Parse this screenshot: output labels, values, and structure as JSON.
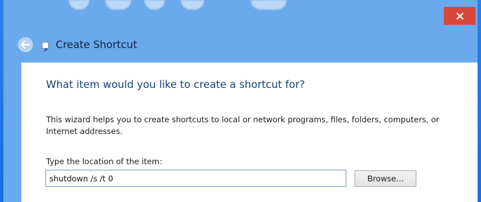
{
  "window": {
    "title": "Create Shortcut",
    "close_icon": "close-icon",
    "back_icon": "back-arrow-icon",
    "app_icon": "shortcut-icon",
    "close_color": "#d9473a",
    "frame_color": "#6aa9ec"
  },
  "wizard": {
    "heading": "What item would you like to create a shortcut for?",
    "description": "This wizard helps you to create shortcuts to local or network programs, files, folders, computers, or Internet addresses.",
    "location_label": "Type the location of the item:",
    "location_value": "shutdown /s /t 0",
    "browse_label": "Browse..."
  }
}
